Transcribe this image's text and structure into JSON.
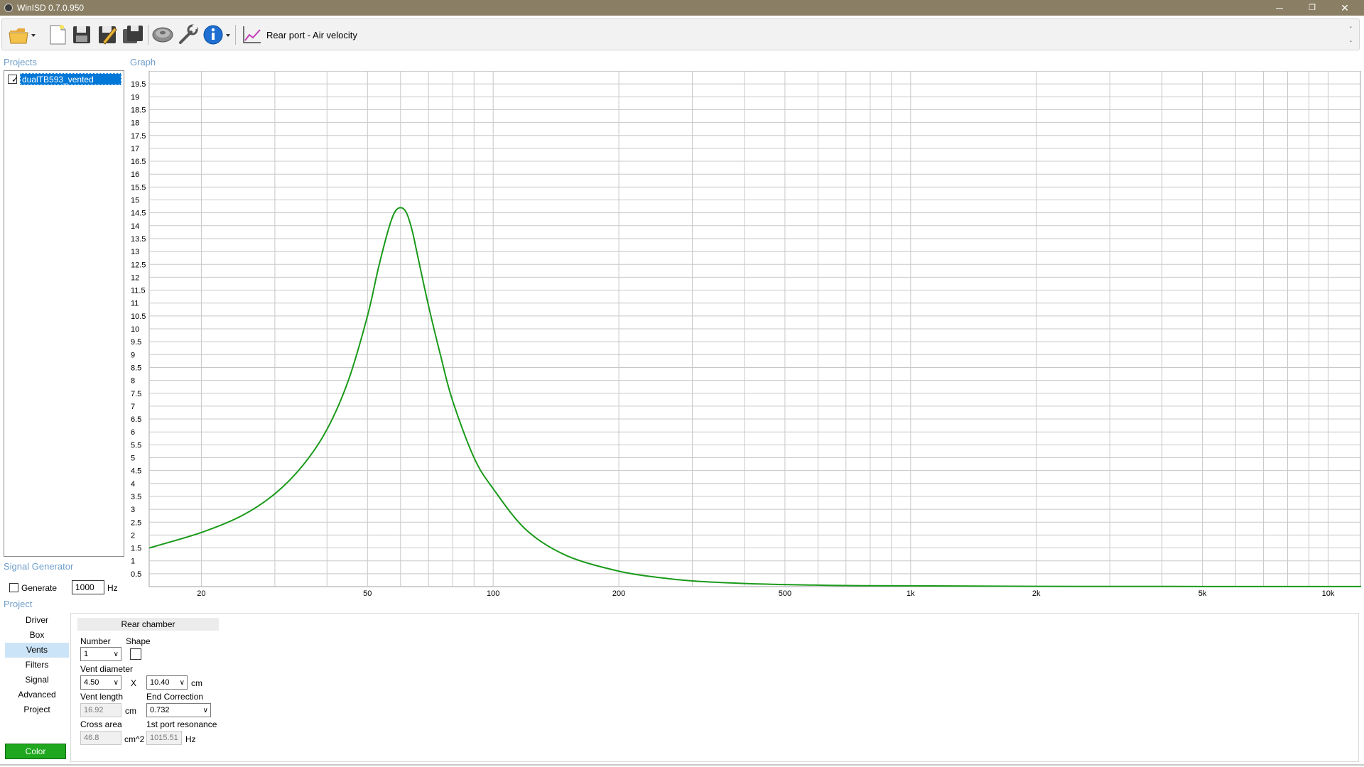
{
  "window": {
    "title": "WinISD 0.7.0.950",
    "minimize": "─",
    "restore": "❐",
    "close": "✕"
  },
  "toolbar": {
    "graph_title": "Rear port - Air velocity",
    "icons": [
      "open-folder-icon",
      "new-document-icon",
      "save-icon",
      "save-as-icon",
      "save-all-icon",
      "driver-icon",
      "tools-wrench-icon",
      "info-icon",
      "graph-icon"
    ],
    "small_marks": [
      "-",
      "-"
    ]
  },
  "sections": {
    "projects": "Projects",
    "graph": "Graph",
    "signal_generator": "Signal Generator",
    "project": "Project"
  },
  "projects": [
    {
      "name": "dualTB593_vented",
      "checked": true
    }
  ],
  "signal_generator": {
    "generate_label": "Generate",
    "frequency": "1000",
    "unit": "Hz"
  },
  "nav": {
    "items": [
      "Driver",
      "Box",
      "Vents",
      "Filters",
      "Signal",
      "Advanced",
      "Project"
    ],
    "active": "Vents",
    "color_button": "Color",
    "color_button_color": "#1fa81f"
  },
  "vents_panel": {
    "tab": "Rear chamber",
    "number_label": "Number",
    "number_value": "1",
    "shape_label": "Shape",
    "vent_diameter_label": "Vent diameter",
    "diameter_value": "4.50",
    "x_label": "X",
    "diameter2_value": "10.40",
    "cm_unit": "cm",
    "vent_length_label": "Vent length",
    "vent_length_value": "16.92",
    "vent_length_unit": "cm",
    "end_correction_label": "End Correction",
    "end_correction_value": "0.732",
    "cross_area_label": "Cross area",
    "cross_area_value": "46.8",
    "cross_area_unit": "cm^2",
    "resonance_label": "1st port resonance",
    "resonance_value": "1015.51",
    "resonance_unit": "Hz"
  },
  "chart_data": {
    "type": "line",
    "x_scale": "log",
    "xlim": [
      15,
      12000
    ],
    "ylim": [
      0,
      20
    ],
    "x_ticks": [
      20,
      50,
      100,
      200,
      500,
      1000,
      2000,
      5000,
      10000
    ],
    "x_tick_labels": [
      "20",
      "50",
      "100",
      "200",
      "500",
      "1k",
      "2k",
      "5k",
      "10k"
    ],
    "y_ticks": [
      0.5,
      1,
      1.5,
      2,
      2.5,
      3,
      3.5,
      4,
      4.5,
      5,
      5.5,
      6,
      6.5,
      7,
      7.5,
      8,
      8.5,
      9,
      9.5,
      10,
      10.5,
      11,
      11.5,
      12,
      12.5,
      13,
      13.5,
      14,
      14.5,
      15,
      15.5,
      16,
      16.5,
      17,
      17.5,
      18,
      18.5,
      19,
      19.5
    ],
    "y_tick_labels": [
      "0.5",
      "1",
      "1.5",
      "2",
      "2.5",
      "3",
      "3.5",
      "4",
      "4.5",
      "5",
      "5.5",
      "6",
      "6.5",
      "7",
      "7.5",
      "8",
      "8.5",
      "9",
      "9.5",
      "10",
      "10.5",
      "11",
      "11.5",
      "12",
      "12.5",
      "13",
      "13.5",
      "14",
      "14.5",
      "15",
      "15.5",
      "16",
      "16.5",
      "17",
      "17.5",
      "18",
      "18.5",
      "19",
      "19.5"
    ],
    "grid": true,
    "series": [
      {
        "color": "#1a9a1a",
        "x": [
          15,
          20,
          25,
          30,
          35,
          40,
          45,
          50,
          53,
          56,
          58,
          60,
          62,
          64,
          66,
          70,
          75,
          80,
          90,
          100,
          120,
          150,
          200,
          250,
          300,
          400,
          500,
          700,
          1000,
          2000,
          5000,
          10000,
          12000
        ],
        "y": [
          1.5,
          2.1,
          2.75,
          3.6,
          4.7,
          6.1,
          8.0,
          10.5,
          12.3,
          13.8,
          14.5,
          14.7,
          14.5,
          13.8,
          12.8,
          10.9,
          8.9,
          7.2,
          5.0,
          3.8,
          2.2,
          1.2,
          0.6,
          0.35,
          0.22,
          0.12,
          0.08,
          0.04,
          0.03,
          0.01,
          0.005,
          0.003,
          0.002
        ]
      }
    ]
  }
}
